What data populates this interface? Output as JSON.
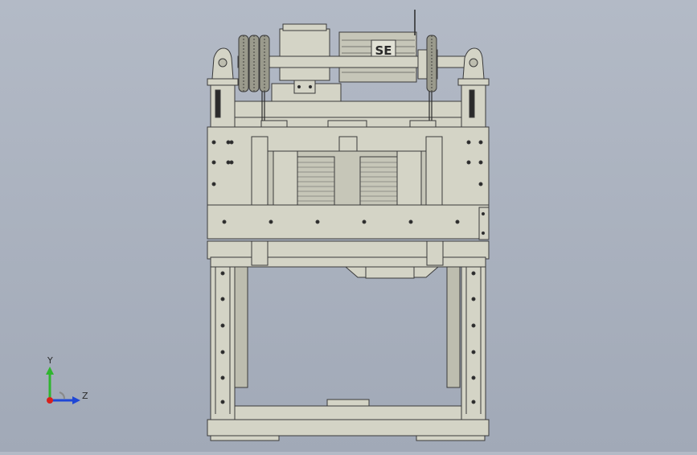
{
  "viewport": {
    "background_top": "#b3bac6",
    "background_bottom": "#a1a9b7",
    "part_fill": "#d4d4c6",
    "part_fill_dark": "#bdbdaf",
    "edge_color": "#3a3a3a"
  },
  "motor": {
    "label": "SE"
  },
  "triad": {
    "x_axis_color": "#d8201c",
    "y_axis_color": "#2fb52f",
    "z_axis_color": "#1f47d6",
    "y_label": "Y",
    "z_label": "Z"
  }
}
